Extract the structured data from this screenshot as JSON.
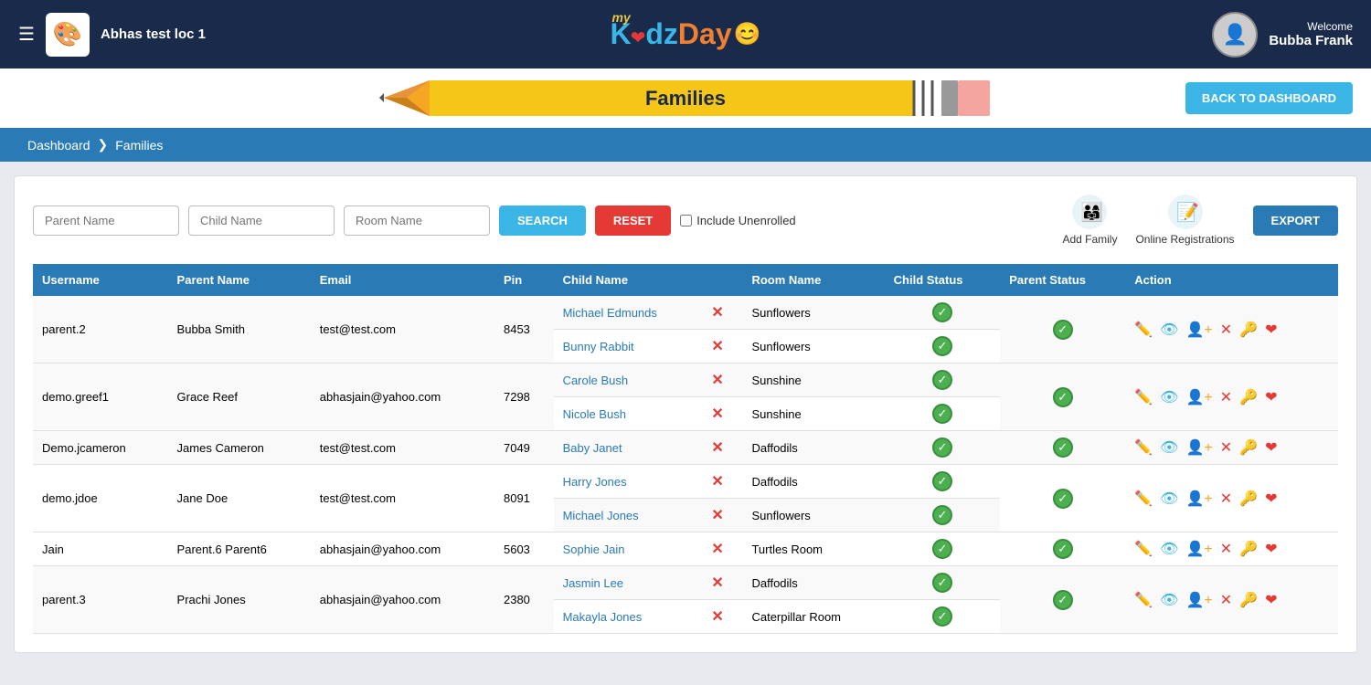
{
  "header": {
    "hamburger": "☰",
    "logo_emoji": "🎨",
    "location": "Abhas test loc 1",
    "brand": {
      "my": "my",
      "kidz": "K❤dz",
      "day": "Day"
    },
    "welcome_label": "Welcome",
    "user_name": "Bubba Frank"
  },
  "banner": {
    "title": "Families",
    "back_button": "BACK TO DASHBOARD"
  },
  "breadcrumb": {
    "dashboard": "Dashboard",
    "separator": "❯",
    "current": "Families"
  },
  "search": {
    "parent_placeholder": "Parent Name",
    "child_placeholder": "Child Name",
    "room_placeholder": "Room Name",
    "search_label": "SEARCH",
    "reset_label": "RESET",
    "include_unenrolled": "Include Unenrolled",
    "add_family_label": "Add Family",
    "online_reg_label": "Online Registrations",
    "export_label": "EXPORT"
  },
  "table": {
    "headers": [
      "Username",
      "Parent Name",
      "Email",
      "Pin",
      "Child Name",
      "",
      "Room Name",
      "Child Status",
      "Parent Status",
      "Action"
    ],
    "rows": [
      {
        "username": "parent.2",
        "parent_name": "Bubba Smith",
        "email": "test@test.com",
        "pin": "8453",
        "parent_status": true,
        "children": [
          {
            "name": "Michael Edmunds",
            "room": "Sunflowers",
            "child_status": true
          },
          {
            "name": "Bunny Rabbit",
            "room": "Sunflowers",
            "child_status": true
          }
        ]
      },
      {
        "username": "demo.greef1",
        "parent_name": "Grace Reef",
        "email": "abhasjain@yahoo.com",
        "pin": "7298",
        "parent_status": true,
        "children": [
          {
            "name": "Carole Bush",
            "room": "Sunshine",
            "child_status": true
          },
          {
            "name": "Nicole Bush",
            "room": "Sunshine",
            "child_status": true
          }
        ]
      },
      {
        "username": "Demo.jcameron",
        "parent_name": "James Cameron",
        "email": "test@test.com",
        "pin": "7049",
        "parent_status": true,
        "children": [
          {
            "name": "Baby Janet",
            "room": "Daffodils",
            "child_status": true
          }
        ]
      },
      {
        "username": "demo.jdoe",
        "parent_name": "Jane Doe",
        "email": "test@test.com",
        "pin": "8091",
        "parent_status": true,
        "children": [
          {
            "name": "Harry Jones",
            "room": "Daffodils",
            "child_status": true
          },
          {
            "name": "Michael Jones",
            "room": "Sunflowers",
            "child_status": true
          }
        ]
      },
      {
        "username": "Jain",
        "parent_name": "Parent.6 Parent6",
        "email": "abhasjain@yahoo.com",
        "pin": "5603",
        "parent_status": true,
        "children": [
          {
            "name": "Sophie Jain",
            "room": "Turtles Room",
            "child_status": true
          }
        ]
      },
      {
        "username": "parent.3",
        "parent_name": "Prachi Jones",
        "email": "abhasjain@yahoo.com",
        "pin": "2380",
        "parent_status": true,
        "children": [
          {
            "name": "Jasmin Lee",
            "room": "Daffodils",
            "child_status": true
          },
          {
            "name": "Makayla Jones",
            "room": "Caterpillar Room",
            "child_status": true
          }
        ]
      }
    ]
  }
}
